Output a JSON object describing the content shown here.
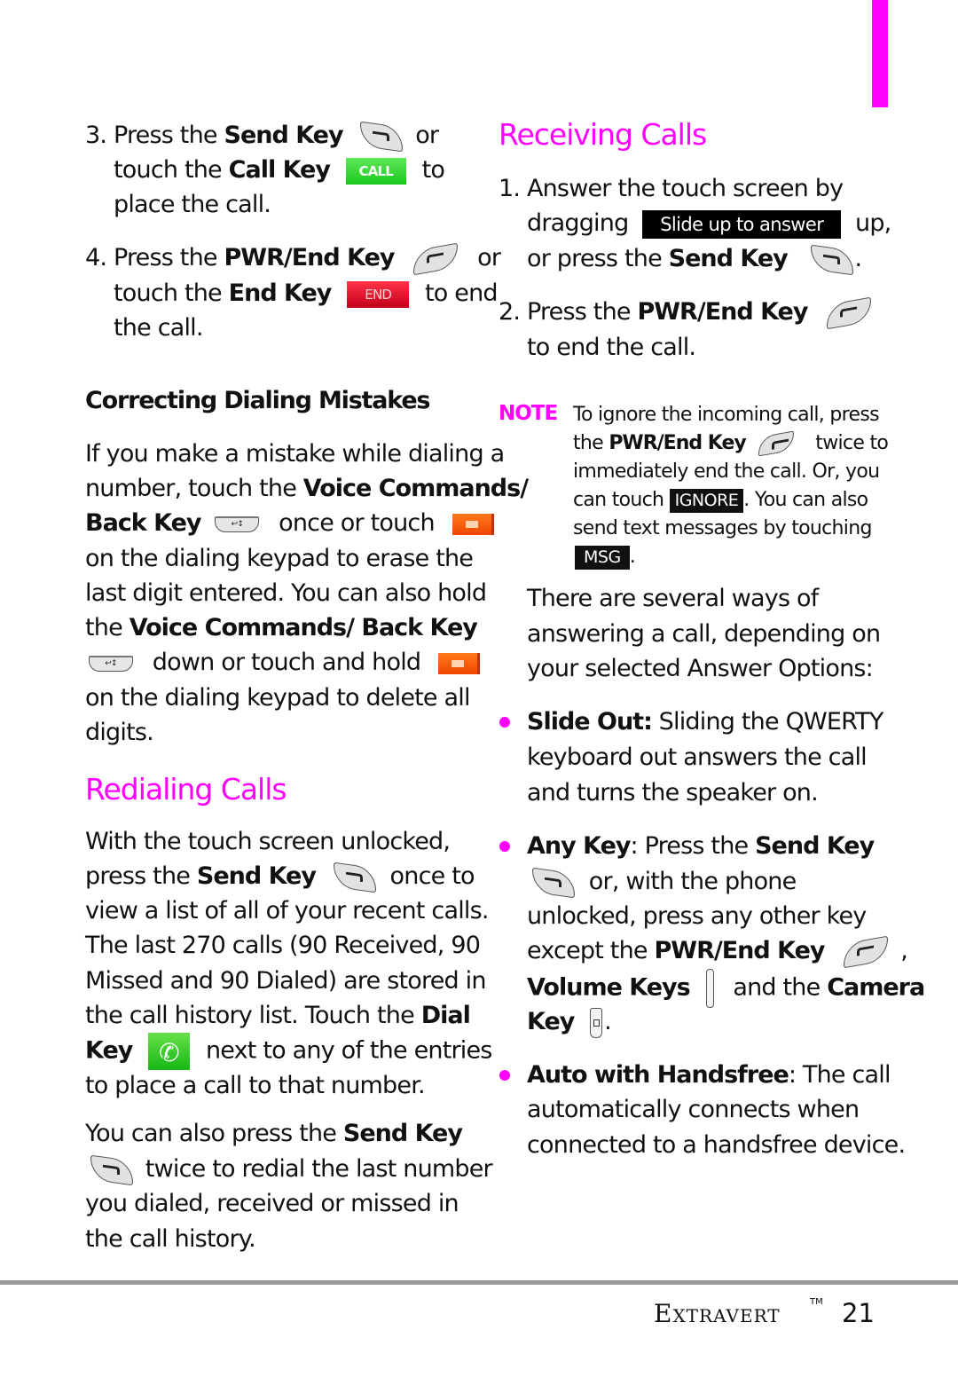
{
  "left": {
    "step3": {
      "line1": {
        "num": "3.",
        "pre": "Press the ",
        "key": "Send Key",
        "post": "or"
      },
      "line2": {
        "pre": "touch the ",
        "key": "Call Key",
        "btn": "CALL",
        "post": "to"
      },
      "line3": "place the call."
    },
    "step4": {
      "line1": {
        "num": "4.",
        "pre": "Press the ",
        "key": "PWR/End Key",
        "post": "or"
      },
      "line2": {
        "pre": "touch the ",
        "key": "End Key",
        "btn": "END",
        "post": "to end"
      },
      "line3": "the call."
    },
    "correcting": {
      "heading": "Correcting Dialing Mistakes",
      "l1": "If you make a mistake while dialing a",
      "l2_pre": "number, touch the ",
      "l2_key": "Voice Commands/",
      "l3_key": "Back Key",
      "l3_post": "once or touch",
      "l4": "on the dialing keypad to erase the",
      "l5": "last digit entered. You can also hold",
      "l6_pre": "the ",
      "l6_key": "Voice Commands/ Back Key",
      "l7_post": "down or touch and hold",
      "l8": "on the dialing keypad to delete all",
      "l9": "digits."
    },
    "redialing": {
      "heading": "Redialing Calls",
      "l1": "With the touch screen unlocked,",
      "l2_pre": "press the ",
      "l2_key": "Send Key",
      "l2_post": "once to",
      "l3": "view a list of all of your recent calls.",
      "l4": "The last 270 calls (90 Received, 90",
      "l5": "Missed and 90 Dialed) are stored in",
      "l6_pre": "the call history list. Touch the ",
      "l6_key": "Dial",
      "l7_key": "Key",
      "l7_post": "next to any of the entries",
      "l8": "to place a call to that number.",
      "p2_l1_pre": "You can also press the ",
      "p2_l1_key": "Send Key",
      "p2_l2": "twice to redial the last number",
      "p2_l3": "you dialed, received or missed in",
      "p2_l4": "the call history."
    }
  },
  "right": {
    "receiving": {
      "heading": "Receiving Calls",
      "s1_l1": "1. Answer the touch screen by",
      "s1_l2_pre": "dragging",
      "s1_slide": "Slide up to answer",
      "s1_l2_post": "up,",
      "s1_l3_pre": "or press the ",
      "s1_l3_key": "Send Key",
      "s1_l3_post": ".",
      "s2_l1_pre": "2. Press the ",
      "s2_l1_key": "PWR/End Key",
      "s2_l2": "to end the call."
    },
    "note": {
      "label": "NOTE",
      "l1": "To ignore the incoming call, press",
      "l2_pre": "the ",
      "l2_key": "PWR/End Key",
      "l2_post": "twice to",
      "l3": "immediately end the call. Or, you",
      "l4_pre": "can touch",
      "l4_tag": "IGNORE",
      "l4_post": ". You can also",
      "l5": "send text messages by touching",
      "l6_tag": "MSG",
      "l6_post": "."
    },
    "ways": {
      "l1": "There are several ways of",
      "l2": "answering a call, depending on",
      "l3": "your selected Answer Options:"
    },
    "bullets": {
      "slide_out": {
        "key": "Slide Out:",
        "l1": " Sliding the QWERTY",
        "l2": "keyboard out answers the call",
        "l3": "and turns the speaker on."
      },
      "any_key": {
        "key": "Any Key",
        "l1_mid": ": Press the ",
        "l1_key": "Send Key",
        "l2": "or, with the phone",
        "l3": "unlocked, press any other key",
        "l4_pre": "except the ",
        "l4_key": "PWR/End Key",
        "l4_post": ",",
        "l5_key": "Volume Keys",
        "l5_mid": "and the ",
        "l5_key2": "Camera",
        "l6_key": "Key",
        "l6_post": "."
      },
      "auto": {
        "key": "Auto with Handsfree",
        "l1": ": The call",
        "l2": "automatically connects when",
        "l3": "connected to a handsfree device."
      }
    }
  },
  "footer": {
    "brand": "Extravert",
    "tm": "TM",
    "page": "21"
  },
  "colors": {
    "accent": "#ff00ff",
    "rule": "#999999"
  }
}
